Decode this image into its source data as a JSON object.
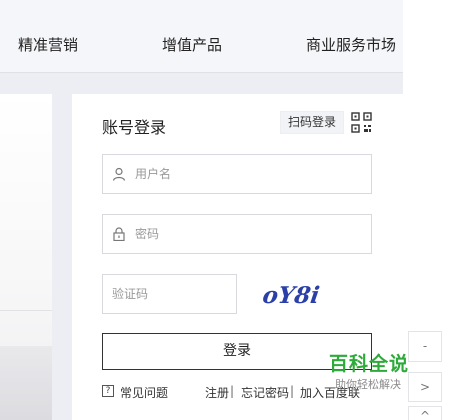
{
  "nav": {
    "items": [
      "精准营销",
      "增值产品",
      "商业服务市场"
    ]
  },
  "login": {
    "title": "账号登录",
    "qr_login_label": "扫码登录",
    "username": {
      "placeholder": "用户名",
      "value": ""
    },
    "password": {
      "placeholder": "密码",
      "value": ""
    },
    "captcha": {
      "placeholder": "验证码",
      "value": "",
      "image_text": "oY8i"
    },
    "submit_label": "登录",
    "links": {
      "faq": "常见问题",
      "register": "注册",
      "separator": "|",
      "forgot": "忘记密码",
      "join": "加入百度联"
    }
  },
  "side_tools": [
    "-",
    ">",
    "^"
  ],
  "watermark": {
    "title": "百科全说",
    "subtitle": "助你轻松解决"
  },
  "colors": {
    "watermark_green": "#2eaa3a",
    "captcha_blue": "#2a3fa8"
  }
}
